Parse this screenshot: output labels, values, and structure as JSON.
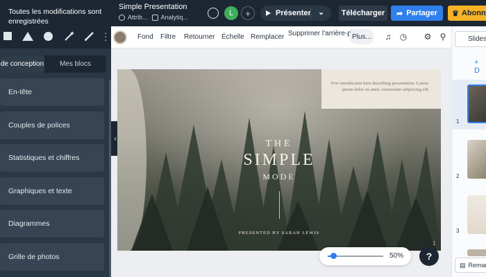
{
  "header": {
    "save_status": "Toutes les modifications sont enregistrées",
    "doc_title": "Simple Presentation",
    "chip_attrib": "Attrib...",
    "chip_analytics": "Analytiq...",
    "avatar_initial": "L",
    "add_user": "+",
    "present_label": "Présenter",
    "download_label": "Télécharger",
    "share_label": "Partager",
    "upgrade_label": "Abonn..."
  },
  "left_panel": {
    "tabs": [
      "de conception",
      "Mes blocs"
    ],
    "categories": [
      "En-tête",
      "Couples de polices",
      "Statistiques et chiffres",
      "Graphiques et texte",
      "Diagrammes",
      "Grille de photos"
    ]
  },
  "toolbar": {
    "items": [
      "Fond",
      "Filtre",
      "Retourner",
      "Échelle",
      "Remplacer"
    ],
    "remove_bg": "Supprimer l'arrière-plan",
    "more_label": "Plus..."
  },
  "slide": {
    "intro": "Few introduction here describing presentation. Lorem ipsum dolor sit amet, consectetur adipiscing elit",
    "the": "THE",
    "simple": "SIMPLE",
    "mode": "MODE",
    "presented_by": "PRESENTED BY SARAH LEWIS",
    "page_number": "1"
  },
  "zoom": {
    "value_label": "50%",
    "level": 0.5
  },
  "help_label": "?",
  "right_panel": {
    "slides_tab": "Slides",
    "add_label": "+ D",
    "thumb_numbers": [
      "1",
      "2",
      "3"
    ],
    "notes_label": "Remar"
  },
  "colors": {
    "accent": "#2f80ed",
    "upgrade": "#f5b325",
    "dark": "#1c2733",
    "avatar": "#3fae5a"
  }
}
